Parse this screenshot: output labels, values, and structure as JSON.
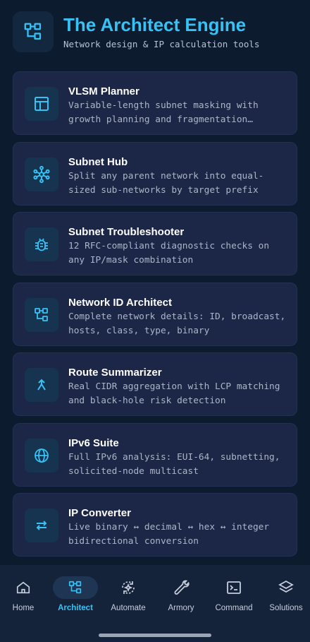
{
  "header": {
    "title": "The Architect Engine",
    "subtitle": "Network design & IP calculation tools",
    "logo_icon": "network-tree-icon"
  },
  "tools": [
    {
      "title": "VLSM Planner",
      "description": "Variable-length subnet masking with growth planning and fragmentation heatmaps",
      "icon": "table-layout-icon"
    },
    {
      "title": "Subnet Hub",
      "description": "Split any parent network into equal-sized sub-networks by target prefix",
      "icon": "hub-icon"
    },
    {
      "title": "Subnet Troubleshooter",
      "description": "12 RFC-compliant diagnostic checks on any IP/mask combination",
      "icon": "bug-icon"
    },
    {
      "title": "Network ID Architect",
      "description": "Complete network details: ID, broadcast, hosts, class, type, binary",
      "icon": "network-tree-icon"
    },
    {
      "title": "Route Summarizer",
      "description": "Real CIDR aggregation with LCP matching and black-hole risk detection",
      "icon": "merge-icon"
    },
    {
      "title": "IPv6 Suite",
      "description": "Full IPv6 analysis: EUI-64, subnetting, solicited-node multicast",
      "icon": "globe-icon"
    },
    {
      "title": "IP Converter",
      "description": "Live binary ↔ decimal ↔ hex ↔ integer bidirectional conversion",
      "icon": "swap-arrows-icon"
    }
  ],
  "nav": {
    "items": [
      {
        "label": "Home",
        "icon": "home-icon",
        "active": false
      },
      {
        "label": "Architect",
        "icon": "network-tree-icon",
        "active": true
      },
      {
        "label": "Automate",
        "icon": "automation-icon",
        "active": false
      },
      {
        "label": "Armory",
        "icon": "wrench-icon",
        "active": false
      },
      {
        "label": "Command",
        "icon": "terminal-icon",
        "active": false
      },
      {
        "label": "Solutions",
        "icon": "layers-icon",
        "active": false
      }
    ]
  },
  "colors": {
    "background": "#0d1b2e",
    "accent": "#37c2f5",
    "card": "#1c2747",
    "nav": "#15233a"
  }
}
